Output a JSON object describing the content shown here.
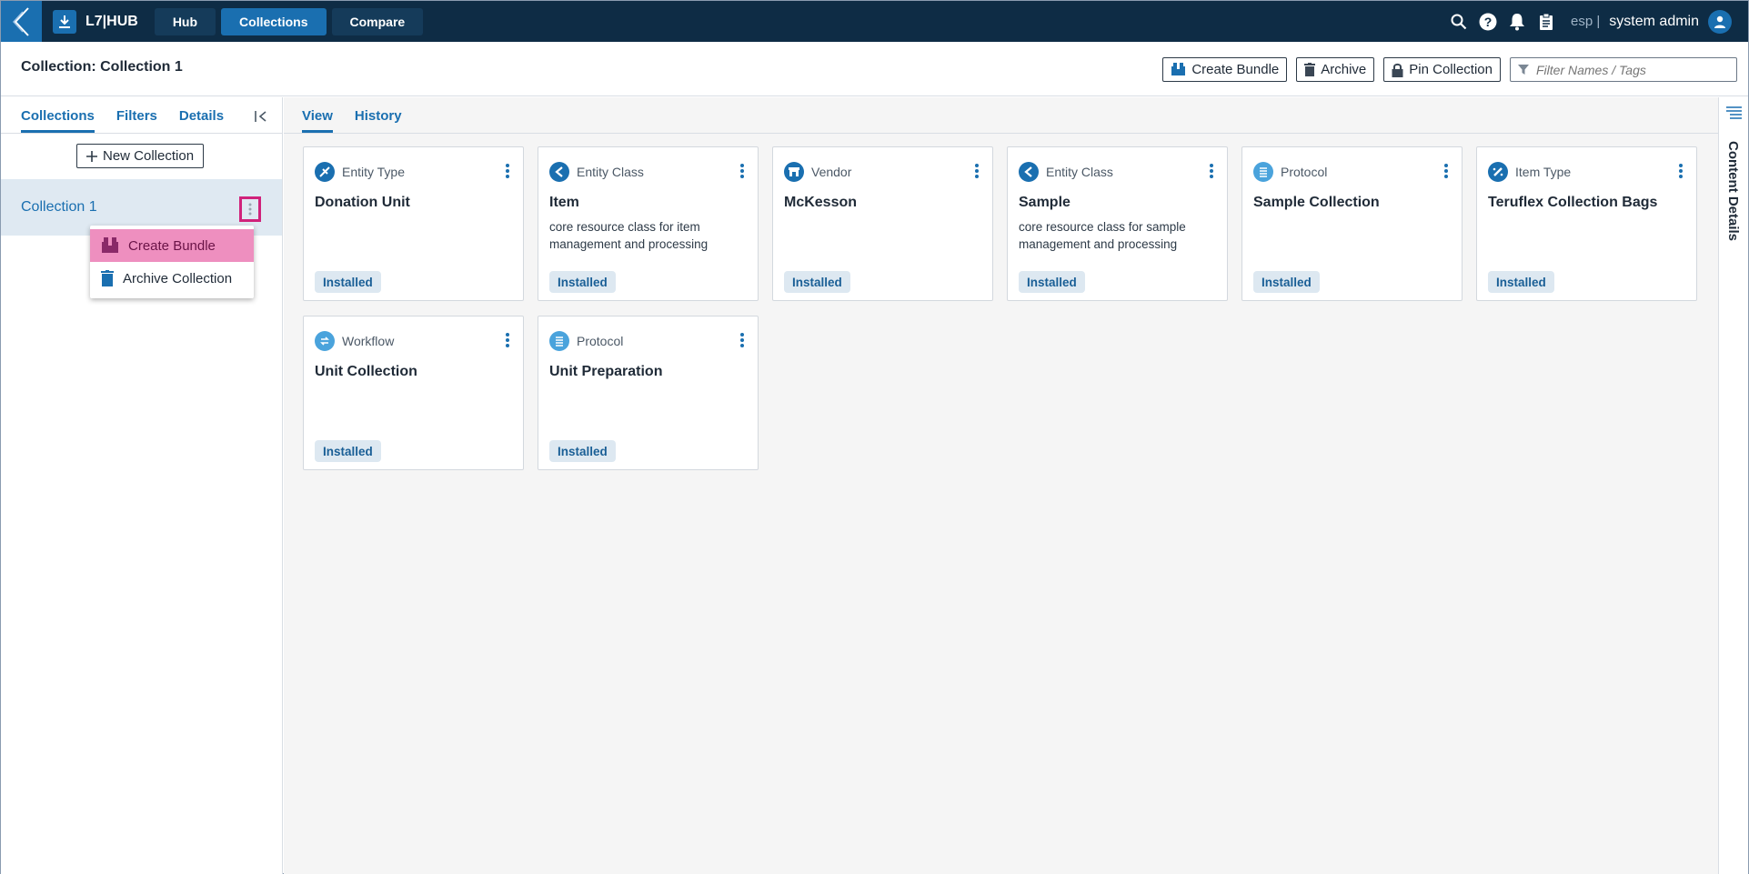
{
  "topbar": {
    "brand": "L7|HUB",
    "nav": [
      "Hub",
      "Collections",
      "Compare"
    ],
    "lang": "esp |",
    "user": "system admin"
  },
  "header": {
    "title": "Collection: Collection 1",
    "create_bundle": "Create Bundle",
    "archive": "Archive",
    "pin": "Pin Collection",
    "filter_placeholder": "Filter Names / Tags"
  },
  "left": {
    "tabs": [
      "Collections",
      "Filters",
      "Details"
    ],
    "new_collection": "New Collection",
    "collection_item": "Collection 1",
    "menu": [
      "Create Bundle",
      "Archive Collection"
    ]
  },
  "main": {
    "tabs": [
      "View",
      "History"
    ],
    "cards": [
      {
        "type": "Entity Type",
        "title": "Donation Unit",
        "desc": "",
        "status": "Installed",
        "icon": "entity-type-icon"
      },
      {
        "type": "Entity Class",
        "title": "Item",
        "desc": "core resource class for item management and processing",
        "status": "Installed",
        "icon": "entity-class-icon"
      },
      {
        "type": "Vendor",
        "title": "McKesson",
        "desc": "",
        "status": "Installed",
        "icon": "vendor-icon"
      },
      {
        "type": "Entity Class",
        "title": "Sample",
        "desc": "core resource class for sample management and processing",
        "status": "Installed",
        "icon": "entity-class-icon"
      },
      {
        "type": "Protocol",
        "title": "Sample Collection",
        "desc": "",
        "status": "Installed",
        "icon": "protocol-icon"
      },
      {
        "type": "Item Type",
        "title": "Teruflex Collection Bags",
        "desc": "",
        "status": "Installed",
        "icon": "item-type-icon"
      },
      {
        "type": "Workflow",
        "title": "Unit Collection",
        "desc": "",
        "status": "Installed",
        "icon": "workflow-icon"
      },
      {
        "type": "Protocol",
        "title": "Unit Preparation",
        "desc": "",
        "status": "Installed",
        "icon": "protocol-icon"
      }
    ]
  },
  "rail": {
    "label": "Content Details"
  },
  "colors": {
    "topbar": "#0e2c45",
    "accent": "#1a6fb0",
    "highlight": "#d0227b",
    "menu_highlight": "#ee8fbf"
  }
}
